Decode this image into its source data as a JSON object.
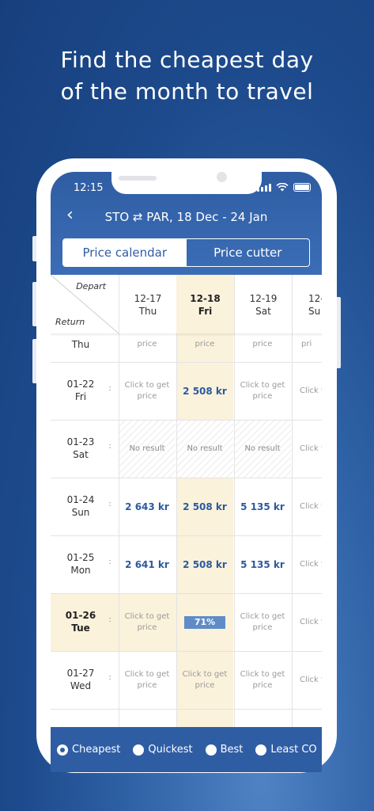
{
  "headline": {
    "line1": "Find the cheapest day",
    "line2": "of the month to travel"
  },
  "status": {
    "time": "12:15"
  },
  "header": {
    "back_icon": "chevron-left-icon",
    "route": "STO ⇄ PAR, 18 Dec - 24 Jan",
    "tabs": [
      {
        "label": "Price calendar",
        "active": true
      },
      {
        "label": "Price cutter",
        "active": false
      }
    ]
  },
  "grid": {
    "corner": {
      "depart": "Depart",
      "return": "Return"
    },
    "columns": [
      {
        "date": "12-17",
        "day": "Thu"
      },
      {
        "date": "12-18",
        "day": "Fri"
      },
      {
        "date": "12-19",
        "day": "Sat"
      },
      {
        "date": "12-",
        "day": "Su"
      }
    ],
    "partial_row": {
      "label": "Thu",
      "cells": [
        "price",
        "price",
        "price",
        "pri"
      ]
    },
    "rows": [
      {
        "date": "01-22",
        "day": "Fri",
        "cells": [
          "Click to get price",
          "2 508 kr",
          "Click to get price",
          "Click t pri"
        ]
      },
      {
        "date": "01-23",
        "day": "Sat",
        "cells": [
          "No result",
          "No result",
          "No result",
          "Click t pri"
        ]
      },
      {
        "date": "01-24",
        "day": "Sun",
        "cells": [
          "2 643 kr",
          "2 508 kr",
          "5 135 kr",
          "Click t pri"
        ]
      },
      {
        "date": "01-25",
        "day": "Mon",
        "cells": [
          "2 641 kr",
          "2 508 kr",
          "5 135 kr",
          "Click t pri"
        ]
      },
      {
        "date": "01-26",
        "day": "Tue",
        "cells": [
          "Click to get price",
          "71%",
          "Click to get price",
          "Click t pri"
        ]
      },
      {
        "date": "01-27",
        "day": "Wed",
        "cells": [
          "Click to get price",
          "Click to get price",
          "Click to get price",
          "Click t pri"
        ]
      }
    ],
    "loading_progress": 0.71,
    "colors": {
      "price": "#2c5aa0",
      "highlight": "#fbf2dc",
      "progress": "#5f8cc6"
    }
  },
  "sort": {
    "options": [
      {
        "label": "Cheapest",
        "selected": true
      },
      {
        "label": "Quickest",
        "selected": false
      },
      {
        "label": "Best",
        "selected": false
      },
      {
        "label": "Least CO",
        "selected": false
      }
    ]
  },
  "colors": {
    "brand": "#2f5da3"
  }
}
